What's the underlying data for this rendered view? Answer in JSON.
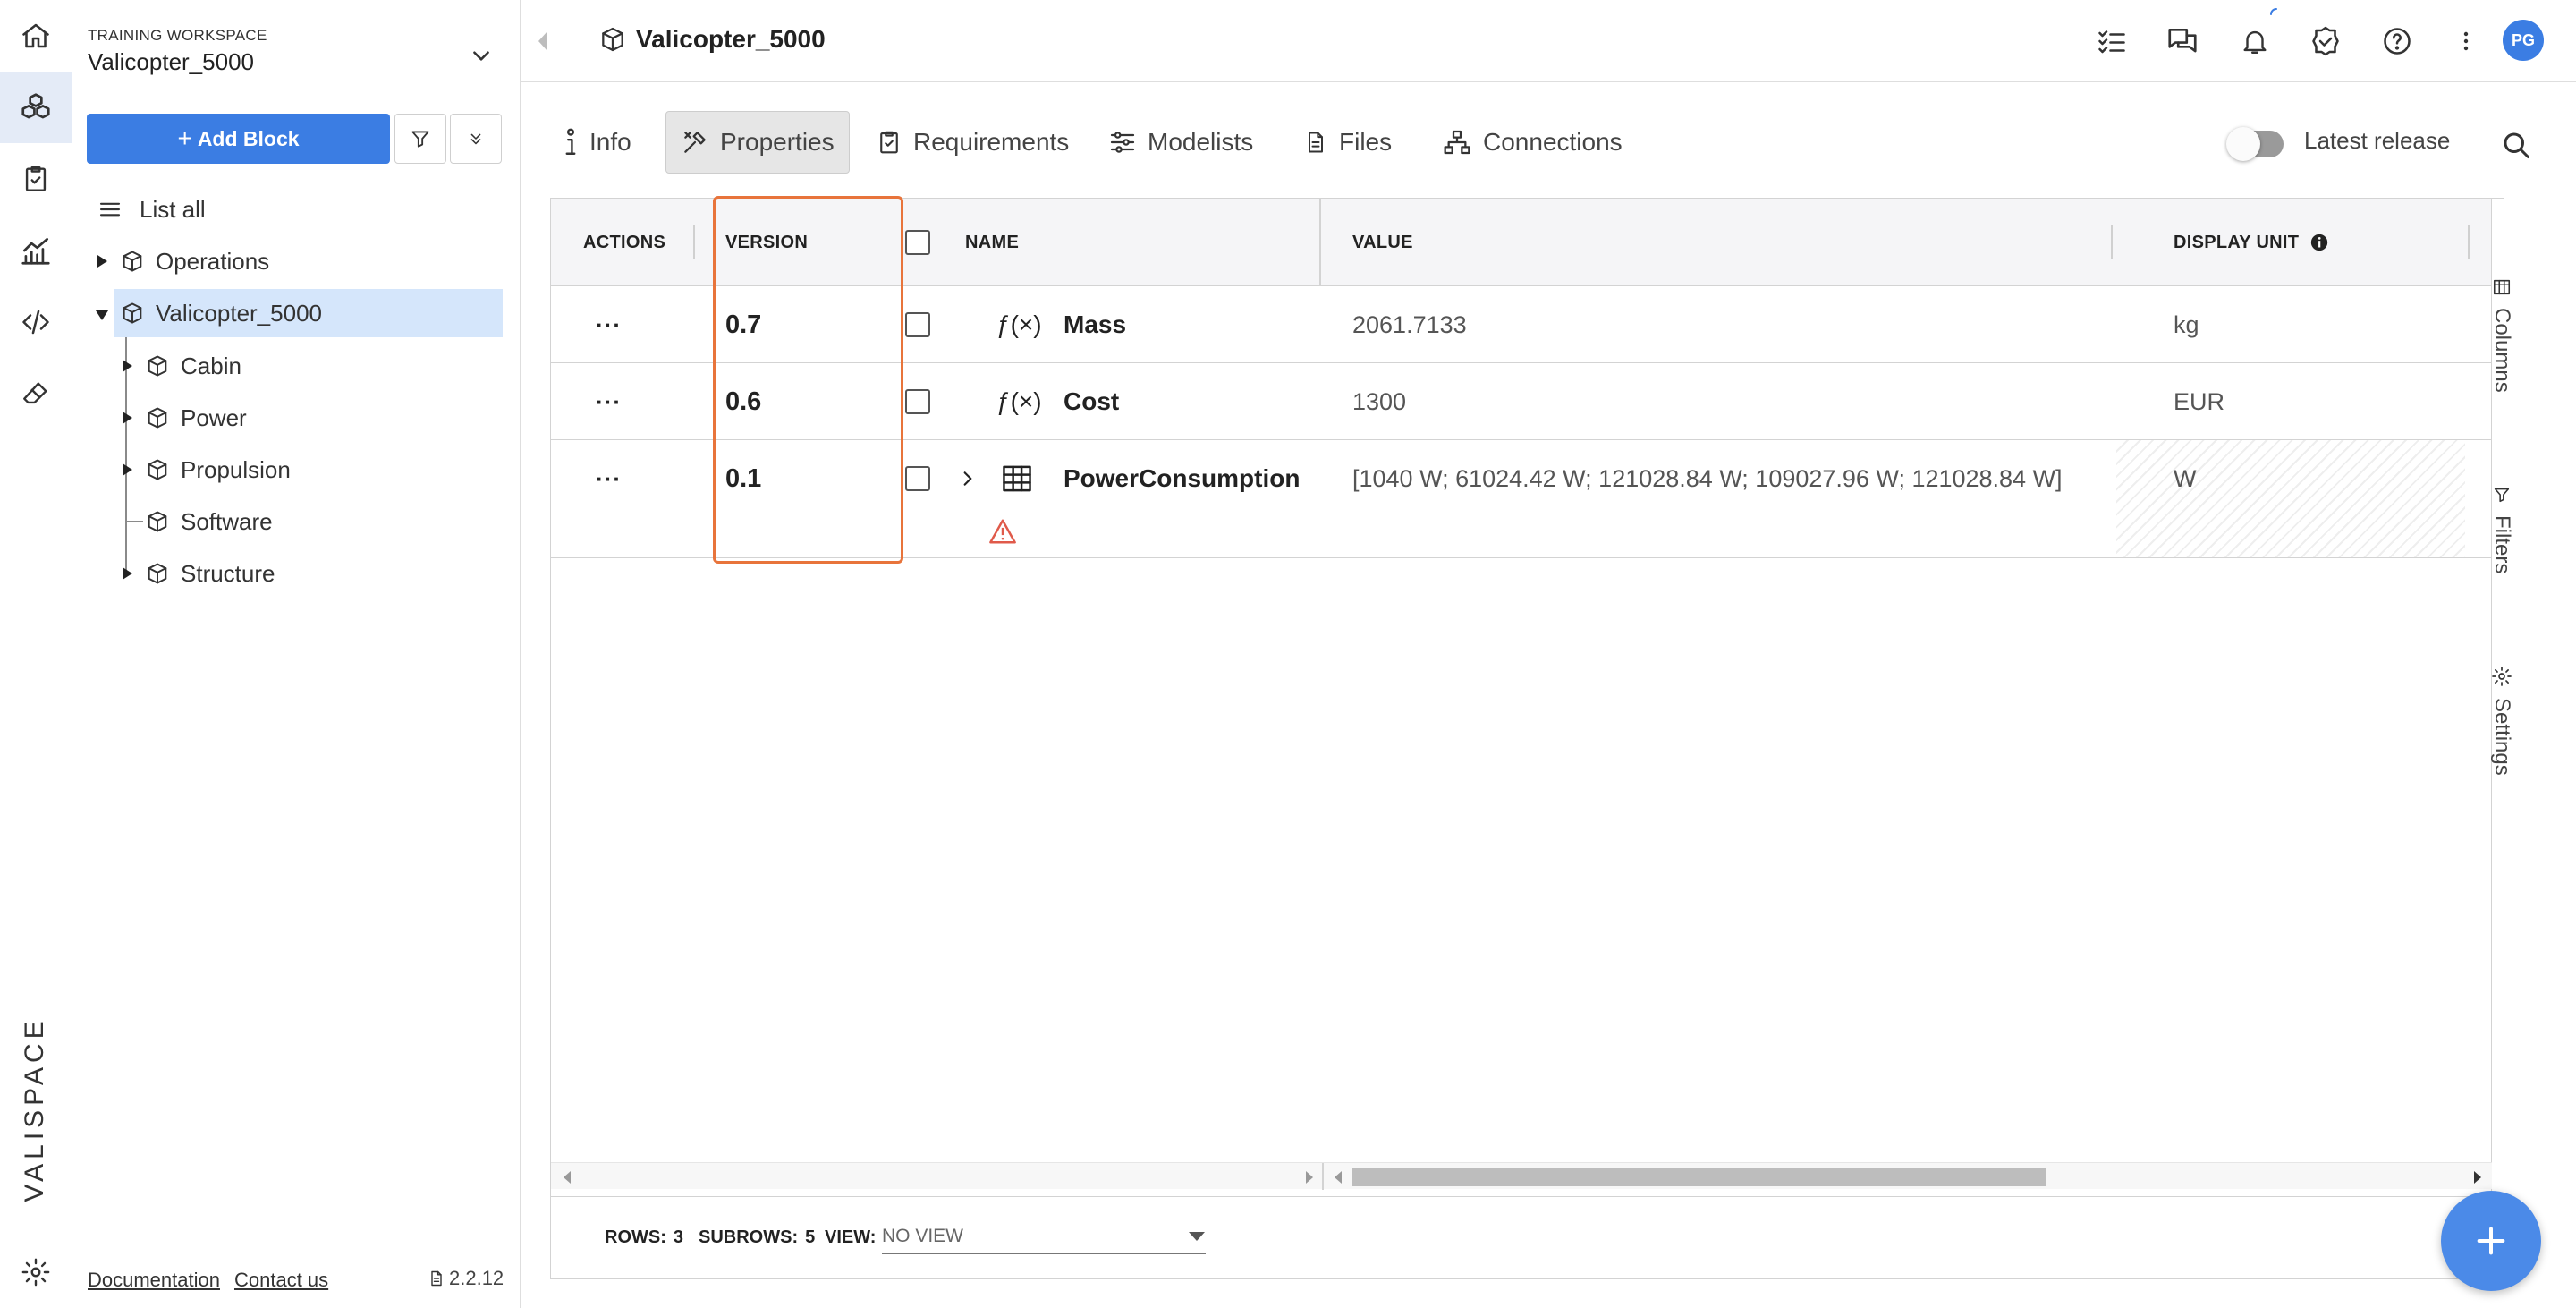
{
  "sidebar": {
    "workspace_label": "TRAINING WORKSPACE",
    "workspace_name": "Valicopter_5000",
    "add_block_label": "Add Block",
    "list_all_label": "List all",
    "tree": [
      {
        "label": "Operations"
      },
      {
        "label": "Valicopter_5000"
      },
      {
        "label": "Cabin"
      },
      {
        "label": "Power"
      },
      {
        "label": "Propulsion"
      },
      {
        "label": "Software"
      },
      {
        "label": "Structure"
      }
    ],
    "footer": {
      "documentation": "Documentation",
      "contact": "Contact us",
      "version": "2.2.12"
    }
  },
  "rail": {
    "logo": "VALISPACE"
  },
  "header": {
    "title": "Valicopter_5000",
    "avatar": "PG"
  },
  "tabs": [
    "Info",
    "Properties",
    "Requirements",
    "Modelists",
    "Files",
    "Connections"
  ],
  "latest_release_label": "Latest release",
  "grid": {
    "columns": [
      "ACTIONS",
      "VERSION",
      "NAME",
      "VALUE",
      "DISPLAY UNIT"
    ],
    "rows": [
      {
        "actions": "···",
        "version": "0.7",
        "name": "Mass",
        "value": "2061.7133",
        "unit": "kg"
      },
      {
        "actions": "···",
        "version": "0.6",
        "name": "Cost",
        "value": "1300",
        "unit": "EUR"
      },
      {
        "actions": "···",
        "version": "0.1",
        "name": "PowerConsumption",
        "value": "[1040 W; 61024.42 W; 121028.84 W; 109027.96 W; 121028.84 W]",
        "unit": "W"
      }
    ],
    "side_tabs": [
      "Columns",
      "Filters",
      "Settings"
    ],
    "footer": {
      "rows_label": "ROWS:",
      "rows_value": "3",
      "subrows_label": "SUBROWS:",
      "subrows_value": "5",
      "view_label": "VIEW:",
      "view_value": "NO VIEW"
    }
  },
  "colors": {
    "accent": "#3b7de3",
    "highlight": "#e8743b",
    "selected": "#d5e6fb"
  }
}
